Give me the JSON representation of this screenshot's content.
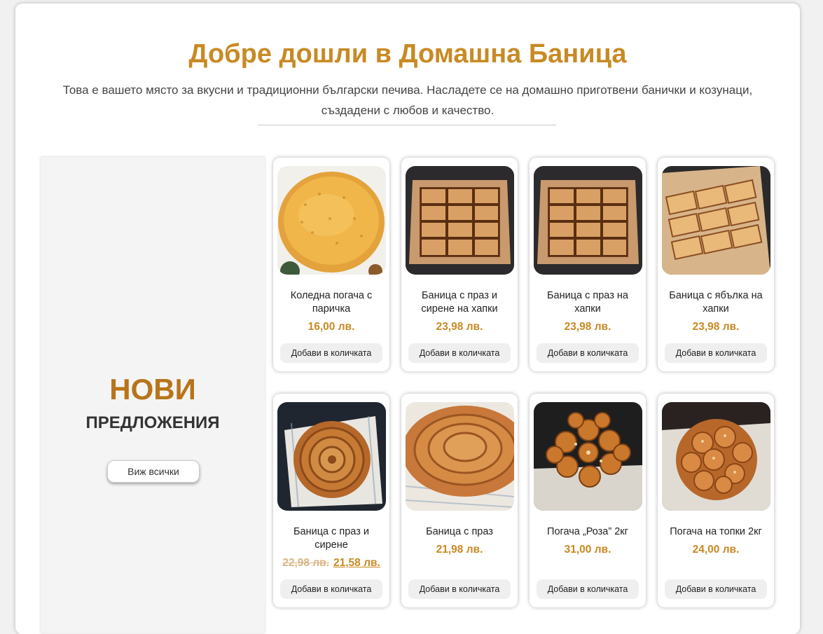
{
  "header": {
    "title": "Добре дошли в Домашна Баница",
    "subtitle": "Това е вашето място за вкусни и традиционни български печива. Насладете се на домашно приготвени банички и козунаци, създадени с любов и качество."
  },
  "promo": {
    "big": "НОВИ",
    "small": "ПРЕДЛОЖЕНИЯ",
    "button": "Виж всички"
  },
  "colors": {
    "accent": "#c88a24",
    "promo_accent": "#b8741a"
  },
  "products": [
    {
      "name": "Коледна погача с паричка",
      "price": "16,00 лв.",
      "button": "Добави в количката",
      "image_icon": "round-bread-image"
    },
    {
      "name": "Баница с праз и сирене на хапки",
      "price": "23,98 лв.",
      "button": "Добави в количката",
      "image_icon": "boxed-banitsa-image"
    },
    {
      "name": "Баница с праз на хапки",
      "price": "23,98 лв.",
      "button": "Добави в количката",
      "image_icon": "boxed-banitsa-image"
    },
    {
      "name": "Баница с ябълка на хапки",
      "price": "23,98 лв.",
      "button": "Добави в количката",
      "image_icon": "boxed-apple-banitsa-image"
    },
    {
      "name": "Баница с праз и сирене",
      "old_price": "22,98 лв.",
      "price": "21,58 лв.",
      "button": "Добави в количката",
      "image_icon": "spiral-banitsa-image"
    },
    {
      "name": "Баница с праз",
      "price": "21,98 лв.",
      "button": "Добави в количката",
      "image_icon": "spiral-banitsa-closeup-image"
    },
    {
      "name": "Погача „Роза” 2кг",
      "price": "31,00 лв.",
      "button": "Добави в количката",
      "image_icon": "rose-pogacha-image"
    },
    {
      "name": "Погача на топки 2кг",
      "price": "24,00 лв.",
      "button": "Добави в количката",
      "image_icon": "ball-pogacha-image"
    }
  ]
}
